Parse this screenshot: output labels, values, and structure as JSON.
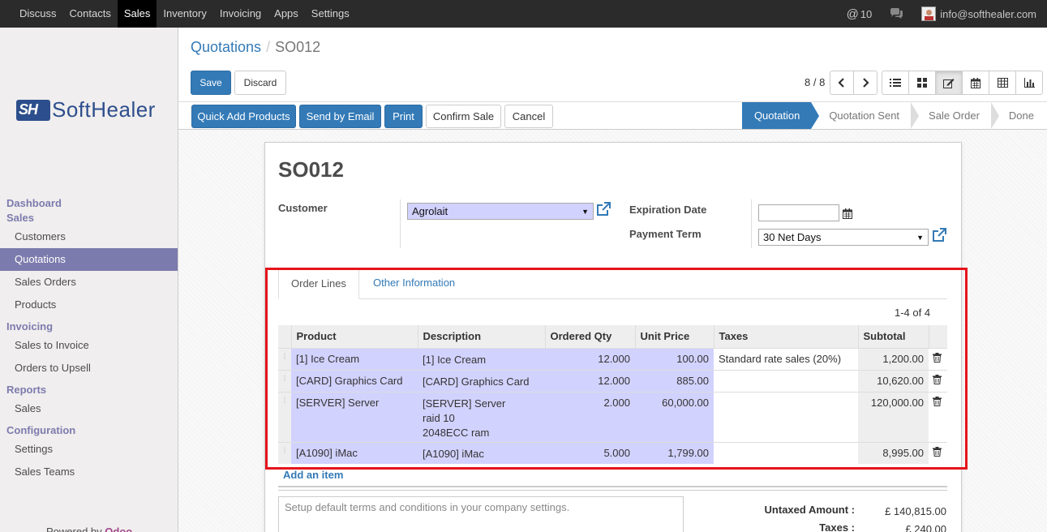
{
  "topbar": {
    "menu": [
      "Discuss",
      "Contacts",
      "Sales",
      "Inventory",
      "Invoicing",
      "Apps",
      "Settings"
    ],
    "active_index": 2,
    "notifications": "10",
    "user_email": "info@softhealer.com"
  },
  "sidebar": {
    "logo_text": "SoftHealer",
    "sections": [
      {
        "head": [
          "Dashboard",
          "Sales"
        ],
        "items": [
          "Customers",
          "Quotations",
          "Sales Orders",
          "Products"
        ]
      },
      {
        "head": [
          "Invoicing"
        ],
        "items": [
          "Sales to Invoice",
          "Orders to Upsell"
        ]
      },
      {
        "head": [
          "Reports"
        ],
        "items": [
          "Sales"
        ]
      },
      {
        "head": [
          "Configuration"
        ],
        "items": [
          "Settings",
          "Sales Teams"
        ]
      }
    ],
    "active_item": "Quotations",
    "powered_prefix": "Powered by",
    "powered_brand": "Odoo"
  },
  "breadcrumb": {
    "parent": "Quotations",
    "current": "SO012"
  },
  "buttons": {
    "save": "Save",
    "discard": "Discard"
  },
  "pager": {
    "value": "8 / 8",
    "prev": "‹",
    "next": "›"
  },
  "statusbar": {
    "actions": [
      "Quick Add Products",
      "Send by Email",
      "Print",
      "Confirm Sale",
      "Cancel"
    ],
    "stages": [
      "Quotation",
      "Quotation Sent",
      "Sale Order",
      "Done"
    ],
    "active_stage": "Quotation"
  },
  "form": {
    "title": "SO012",
    "customer_label": "Customer",
    "customer_value": "Agrolait",
    "expiration_label": "Expiration Date",
    "expiration_value": "",
    "payment_label": "Payment Term",
    "payment_value": "30 Net Days"
  },
  "tabs": [
    "Order Lines",
    "Other Information"
  ],
  "lines_count": "1-4 of 4",
  "table": {
    "headers": [
      "Product",
      "Description",
      "Ordered Qty",
      "Unit Price",
      "Taxes",
      "Subtotal"
    ],
    "rows": [
      {
        "product": "[1] Ice Cream",
        "description": [
          "[1] Ice Cream"
        ],
        "qty": "12.000",
        "price": "100.00",
        "taxes": "Standard rate sales (20%)",
        "subtotal": "1,200.00"
      },
      {
        "product": "[CARD] Graphics Card",
        "description": [
          "[CARD] Graphics Card"
        ],
        "qty": "12.000",
        "price": "885.00",
        "taxes": "",
        "subtotal": "10,620.00"
      },
      {
        "product": "[SERVER] Server",
        "description": [
          "[SERVER] Server",
          "raid 10",
          "2048ECC ram"
        ],
        "qty": "2.000",
        "price": "60,000.00",
        "taxes": "",
        "subtotal": "120,000.00"
      },
      {
        "product": "[A1090] iMac",
        "description": [
          "[A1090] iMac"
        ],
        "qty": "5.000",
        "price": "1,799.00",
        "taxes": "",
        "subtotal": "8,995.00"
      }
    ]
  },
  "add_item": "Add an item",
  "notes_placeholder": "Setup default terms and conditions in your company settings.",
  "totals": {
    "untaxed_label": "Untaxed Amount :",
    "untaxed_value": "£ 140,815.00",
    "taxes_label": "Taxes :",
    "taxes_value": "£ 240.00"
  },
  "colors": {
    "accent": "#337ab7",
    "sidebar_active": "#7c7bad",
    "required_field": "#d2d2ff",
    "highlight_box": "#e5141c"
  }
}
